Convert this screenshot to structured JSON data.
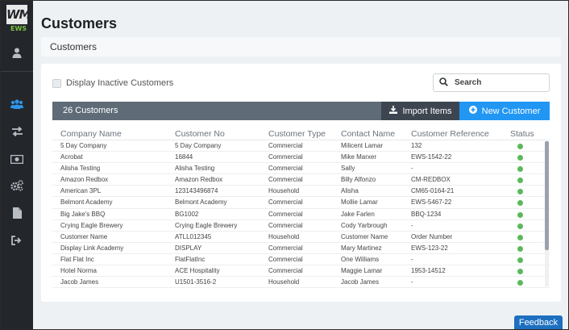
{
  "app": {
    "logo_text": "WM",
    "logo_sub": "EWS"
  },
  "sidebar": {
    "icons": [
      "user-icon",
      "users-icon",
      "transfer-icon",
      "money-icon",
      "gears-icon",
      "document-icon",
      "logout-icon"
    ],
    "active_color": "#2f95e8"
  },
  "page": {
    "title": "Customers",
    "breadcrumb": "Customers"
  },
  "filters": {
    "inactive_label": "Display Inactive Customers",
    "inactive_checked": false
  },
  "search": {
    "placeholder": "Search"
  },
  "toolbar": {
    "count_label": "26 Customers",
    "import_label": "Import Items",
    "new_label": "New Customer"
  },
  "table": {
    "columns": [
      "Company Name",
      "Customer No",
      "Customer Type",
      "Contact Name",
      "Customer Reference",
      "Status"
    ],
    "rows": [
      [
        "5 Day Company",
        "5 Day Company",
        "Commercial",
        "Milicent Lamar",
        "132",
        "active"
      ],
      [
        "Acrobat",
        "16844",
        "Commercial",
        "Mike Marxer",
        "EWS-1542-22",
        "active"
      ],
      [
        "Alisha Testing",
        "Alisha Testing",
        "Commercial",
        "Sally",
        "-",
        "active"
      ],
      [
        "Amazon Redbox",
        "Amazon Redbox",
        "Commercial",
        "Billy Alfonzo",
        "CM-REDBOX",
        "active"
      ],
      [
        "American 3PL",
        "123143496874",
        "Household",
        "Alisha",
        "CM65-0164-21",
        "active"
      ],
      [
        "Belmont Academy",
        "Belmont Academy",
        "Commercial",
        "Mollie Lamar",
        "EWS-5467-22",
        "active"
      ],
      [
        "Big Jake's BBQ",
        "BG1002",
        "Commercial",
        "Jake Farlen",
        "BBQ-1234",
        "active"
      ],
      [
        "Crying Eagle Brewery",
        "Crying Eagle Brewery",
        "Commercial",
        "Cody Yarbrough",
        "-",
        "active"
      ],
      [
        "Customer Name",
        "ATLL012345",
        "Household",
        "Customer Name",
        "Order Number",
        "active"
      ],
      [
        "Display Link Academy",
        "DISPLAY",
        "Commercial",
        "Mary Martinez",
        "EWS-123-22",
        "active"
      ],
      [
        "Flat Flat Inc",
        "FlatFlatInc",
        "Commercial",
        "One Williams",
        "-",
        "active"
      ],
      [
        "Hotel Norma",
        "ACE Hospitality",
        "Commercial",
        "Maggie Lamar",
        "1953-14512",
        "active"
      ],
      [
        "Jacob James",
        "U1501-3516-2",
        "Household",
        "Jacob James",
        "-",
        "active"
      ]
    ]
  },
  "feedback": {
    "label": "Feedback"
  },
  "colors": {
    "sidebar_bg": "#23272c",
    "toolbar_bg": "#5f6b77",
    "primary": "#2196f3",
    "status_active": "#5cb85c"
  }
}
